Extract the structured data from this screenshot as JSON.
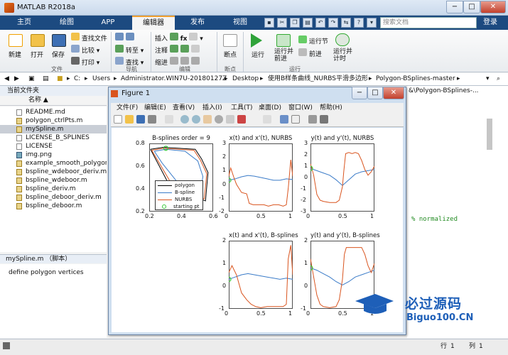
{
  "window": {
    "title": "MATLAB R2018a",
    "min": "−",
    "max": "□",
    "close": "✕"
  },
  "tabs": [
    "主页",
    "绘图",
    "APP",
    "编辑器",
    "发布",
    "视图"
  ],
  "search": {
    "placeholder": "搜索文档"
  },
  "login": "登录",
  "ribbon": {
    "new": "新建",
    "open": "打开",
    "save": "保存",
    "find_files": "查找文件",
    "compare": "比较",
    "print": "打印",
    "goto": "转至",
    "find": "查找",
    "insert": "插入",
    "fx": "fx",
    "comment": "注释",
    "indent": "缩进",
    "breakpoints": "断点",
    "run": "运行",
    "run_advance": "运行并\n前进",
    "run_section": "运行节",
    "advance": "前进",
    "run_time": "运行并\n计时",
    "groups": [
      "文件",
      "导航",
      "编辑",
      "断点",
      "运行"
    ]
  },
  "address": {
    "parts": [
      "C:",
      "Users",
      "Administrator.WIN7U-20180127Z",
      "Desktop",
      "使用B样条曲线_NURBS平滑多边形",
      "Polygon-BSplines-master"
    ]
  },
  "current_folder": {
    "header": "当前文件夹",
    "col": "名称 ▲",
    "files": [
      "README.md",
      "polygon_ctrlPts.m",
      "mySpline.m",
      "LICENSE_B_SPLINES",
      "LICENSE",
      "img.png",
      "example_smooth_polygon.m",
      "bspline_wdeboor_deriv.m",
      "bspline_wdeboor.m",
      "bspline_deriv.m",
      "bspline_deboor_deriv.m",
      "bspline_deboor.m"
    ],
    "selected": 2
  },
  "details": {
    "header": "mySpline.m （脚本）",
    "text": "define polygon vertices"
  },
  "editor": {
    "path_text": "&\\Polygon-BSplines-...",
    "code_snip": "% normalized"
  },
  "status": {
    "row_label": "行",
    "row": "1",
    "col_label": "列",
    "col": "1"
  },
  "figure": {
    "title": "Figure 1",
    "menus": [
      "文件(F)",
      "编辑(E)",
      "查看(V)",
      "插入(I)",
      "工具(T)",
      "桌面(D)",
      "窗口(W)",
      "帮助(H)"
    ]
  },
  "chart_data": [
    {
      "type": "line",
      "title": "B-splines order = 9",
      "xlim": [
        0.2,
        0.7
      ],
      "ylim": [
        0.2,
        0.9
      ],
      "xticks": [
        "0.2",
        "0.4",
        "0.6"
      ],
      "yticks": [
        "0.2",
        "0.4",
        "0.6",
        "0.8"
      ],
      "legend": {
        "placement": "bottom-left",
        "entries": [
          "polygon",
          "B-spline",
          "NURBS",
          "starting pt"
        ]
      },
      "series": [
        {
          "name": "polygon",
          "color": "#000000",
          "x": [
            0.21,
            0.31,
            0.56,
            0.61,
            0.66,
            0.64,
            0.37,
            0.21
          ],
          "y": [
            0.84,
            0.86,
            0.84,
            0.74,
            0.6,
            0.31,
            0.44,
            0.84
          ]
        },
        {
          "name": "B-spline",
          "color": "#3a7bc8",
          "x": [
            0.24,
            0.33,
            0.48,
            0.58,
            0.62,
            0.6,
            0.44,
            0.3,
            0.24
          ],
          "y": [
            0.82,
            0.84,
            0.82,
            0.72,
            0.56,
            0.4,
            0.47,
            0.7,
            0.82
          ]
        },
        {
          "name": "NURBS",
          "color": "#d9541e",
          "x": [
            0.22,
            0.31,
            0.55,
            0.6,
            0.65,
            0.63,
            0.39,
            0.22
          ],
          "y": [
            0.83,
            0.85,
            0.83,
            0.73,
            0.59,
            0.33,
            0.45,
            0.83
          ]
        },
        {
          "name": "starting pt",
          "color": "#3cc83c",
          "x": [
            0.33
          ],
          "y": [
            0.85
          ]
        }
      ]
    },
    {
      "type": "line",
      "title": "x(t) and x'(t), NURBS",
      "xlim": [
        0,
        1
      ],
      "ylim": [
        -2,
        3
      ],
      "xticks": [
        "0",
        "0.5",
        "1"
      ],
      "yticks": [
        "-2",
        "-1",
        "0",
        "1",
        "2",
        "3"
      ],
      "series": [
        {
          "name": "x",
          "color": "#3a7bc8",
          "x": [
            0,
            0.1,
            0.2,
            0.3,
            0.4,
            0.5,
            0.6,
            0.7,
            0.8,
            0.9,
            1
          ],
          "y": [
            0.3,
            0.4,
            0.55,
            0.65,
            0.6,
            0.5,
            0.4,
            0.3,
            0.3,
            0.4,
            0.35
          ]
        },
        {
          "name": "x'",
          "color": "#d9541e",
          "x": [
            0,
            0.03,
            0.08,
            0.12,
            0.2,
            0.28,
            0.32,
            0.38,
            0.45,
            0.5,
            0.55,
            0.62,
            0.7,
            0.78,
            0.85,
            0.9,
            0.93,
            0.97,
            1
          ],
          "y": [
            0.6,
            1.2,
            0.5,
            0,
            -0.6,
            -0.7,
            -1.4,
            -1.5,
            -1.5,
            -1.5,
            -1.5,
            -1.6,
            -1.5,
            -1.5,
            -1.6,
            -1.5,
            -0.3,
            1.8,
            0.6
          ]
        },
        {
          "name": "start",
          "color": "#3cc83c",
          "x": [
            0
          ],
          "y": [
            0.3
          ]
        }
      ]
    },
    {
      "type": "line",
      "title": "y(t) and y'(t), NURBS",
      "xlim": [
        0,
        1
      ],
      "ylim": [
        -3,
        3
      ],
      "xticks": [
        "0",
        "0.5",
        "1"
      ],
      "yticks": [
        "-3",
        "-2",
        "-1",
        "0",
        "1",
        "2",
        "3"
      ],
      "series": [
        {
          "name": "y",
          "color": "#3a7bc8",
          "x": [
            0,
            0.1,
            0.2,
            0.3,
            0.4,
            0.5,
            0.6,
            0.7,
            0.8,
            0.9,
            1
          ],
          "y": [
            0.8,
            0.6,
            0.4,
            0.2,
            -0.2,
            -0.7,
            -0.2,
            0.3,
            0.5,
            0.6,
            0.7
          ]
        },
        {
          "name": "y'",
          "color": "#d9541e",
          "x": [
            0,
            0.05,
            0.1,
            0.15,
            0.2,
            0.3,
            0.4,
            0.45,
            0.5,
            0.52,
            0.55,
            0.6,
            0.65,
            0.7,
            0.75,
            0.8,
            0.85,
            0.9,
            0.95,
            1
          ],
          "y": [
            1.2,
            0.2,
            -1.5,
            -2,
            -2.1,
            -2.2,
            -2.2,
            -2,
            -0.8,
            0.5,
            2.1,
            2.2,
            2.1,
            2.2,
            2.1,
            1.5,
            0.7,
            0.2,
            0.5,
            1.0
          ]
        },
        {
          "name": "start",
          "color": "#3cc83c",
          "x": [
            0
          ],
          "y": [
            0.8
          ]
        }
      ]
    },
    {
      "type": "line",
      "title": "x(t) and x'(t), B-splines",
      "xlim": [
        0,
        1
      ],
      "ylim": [
        -1,
        2
      ],
      "xticks": [
        "0",
        "0.5",
        "1"
      ],
      "yticks": [
        "-1",
        "0",
        "1",
        "2"
      ],
      "series": [
        {
          "name": "x",
          "color": "#3a7bc8",
          "x": [
            0,
            0.1,
            0.2,
            0.3,
            0.4,
            0.5,
            0.6,
            0.7,
            0.8,
            0.9,
            1
          ],
          "y": [
            0.3,
            0.4,
            0.5,
            0.55,
            0.5,
            0.45,
            0.4,
            0.35,
            0.3,
            0.35,
            0.3
          ]
        },
        {
          "name": "x'",
          "color": "#d9541e",
          "x": [
            0,
            0.05,
            0.12,
            0.2,
            0.28,
            0.35,
            0.42,
            0.5,
            0.6,
            0.7,
            0.8,
            0.85,
            0.9,
            0.93,
            0.97,
            1
          ],
          "y": [
            0.6,
            0.9,
            0.5,
            -0.3,
            -0.6,
            -0.8,
            -0.9,
            -0.95,
            -0.9,
            -0.9,
            -0.9,
            -0.9,
            -0.8,
            1.2,
            1.8,
            0.5
          ]
        },
        {
          "name": "start",
          "color": "#3cc83c",
          "x": [
            0
          ],
          "y": [
            0.3
          ]
        }
      ]
    },
    {
      "type": "line",
      "title": "y(t) and y'(t), B-splines",
      "xlim": [
        0,
        1
      ],
      "ylim": [
        -1,
        2
      ],
      "xticks": [
        "0",
        "0.5",
        "1"
      ],
      "yticks": [
        "-1",
        "0",
        "1",
        "2"
      ],
      "series": [
        {
          "name": "y",
          "color": "#3a7bc8",
          "x": [
            0,
            0.1,
            0.2,
            0.3,
            0.4,
            0.5,
            0.6,
            0.7,
            0.8,
            0.9,
            1
          ],
          "y": [
            0.8,
            0.7,
            0.55,
            0.4,
            0.2,
            0.05,
            0.2,
            0.4,
            0.5,
            0.6,
            0.7
          ]
        },
        {
          "name": "y'",
          "color": "#d9541e",
          "x": [
            0,
            0.05,
            0.1,
            0.15,
            0.2,
            0.3,
            0.4,
            0.45,
            0.5,
            0.53,
            0.56,
            0.6,
            0.7,
            0.8,
            0.85,
            0.9,
            0.95,
            1
          ],
          "y": [
            1.2,
            0.4,
            -0.4,
            -0.8,
            -0.9,
            -0.95,
            -0.9,
            -0.6,
            0.3,
            1.4,
            1.7,
            1.7,
            1.7,
            1.7,
            1.4,
            0.9,
            0.6,
            1.0
          ]
        },
        {
          "name": "start",
          "color": "#3cc83c",
          "x": [
            0
          ],
          "y": [
            0.8
          ]
        }
      ]
    }
  ],
  "watermark": {
    "cn": "必过源码",
    "en": "Biguo100.CN"
  }
}
